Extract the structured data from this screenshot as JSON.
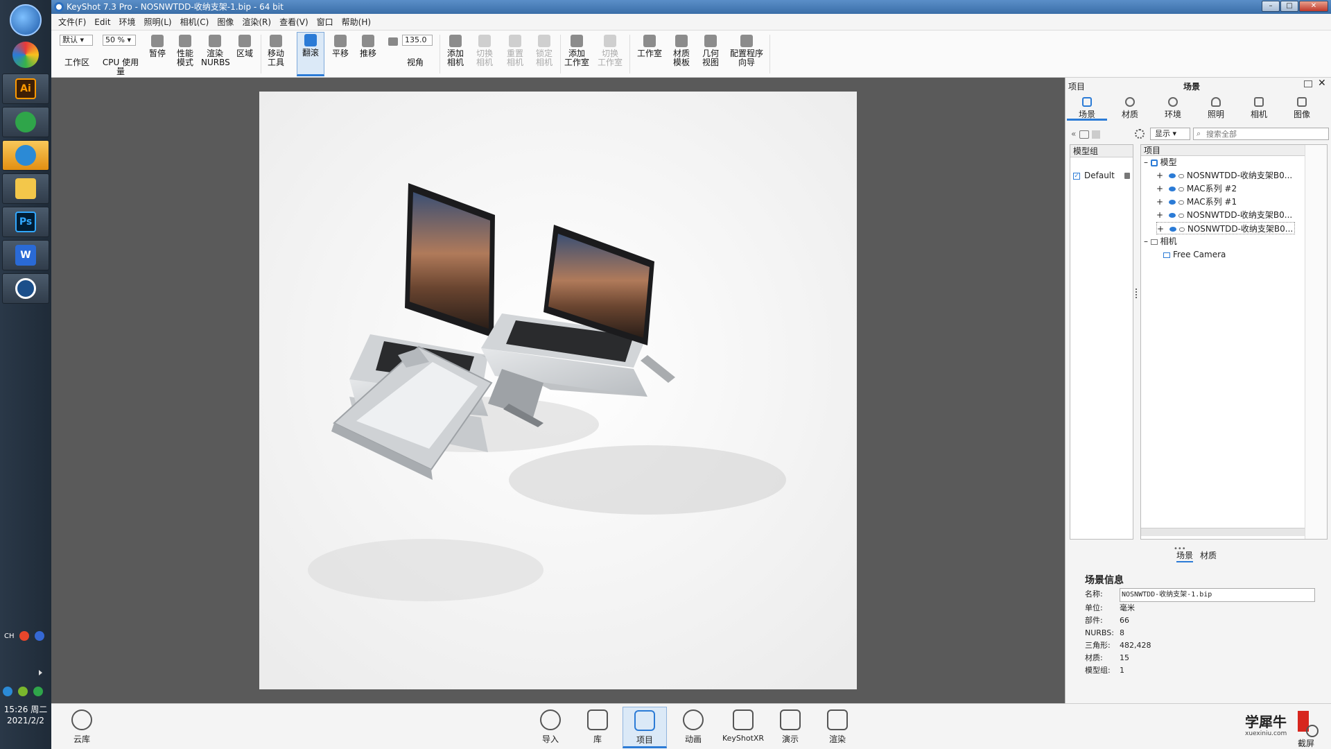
{
  "window": {
    "title": "KeyShot 7.3 Pro  - NOSNWTDD-收纳支架-1.bip  - 64 bit"
  },
  "menu": [
    "文件(F)",
    "Edit",
    "环境",
    "照明(L)",
    "相机(C)",
    "图像",
    "渲染(R)",
    "查看(V)",
    "窗口",
    "帮助(H)"
  ],
  "toolbar": {
    "workspace_select": "默认",
    "workspace_label": "工作区",
    "zoom_select": "50 %",
    "cpu_label": "CPU 使用量",
    "pause_label": "暂停",
    "perf_label": "性能\n模式",
    "nurbs_label": "渲染\nNURBS",
    "region_label": "区域",
    "move_label": "移动\n工具",
    "tumble_label": "翻滚",
    "pan_label": "平移",
    "dolly_label": "推移",
    "fov_value": "135.0",
    "fov_label": "视角",
    "add_cam_label": "添加\n相机",
    "switch_cam_label": "切换\n相机",
    "reset_cam_label": "重置\n相机",
    "lock_cam_label": "锁定\n相机",
    "add_studio_label": "添加\n工作室",
    "switch_studio_label": "切换\n工作室",
    "studio_label": "工作室",
    "mat_template_label": "材质\n模板",
    "geo_view_label": "几何\n视图",
    "wizard_label": "配置程序\n向导"
  },
  "panel": {
    "header_left": "项目",
    "header_center": "场景",
    "tabs": [
      "场景",
      "材质",
      "环境",
      "照明",
      "相机",
      "图像"
    ],
    "display_select": "显示",
    "search_placeholder": "搜索全部",
    "model_group_header": "模型组",
    "model_group_item": "Default",
    "tree_header": "项目",
    "tree_models": "模型",
    "tree_items": [
      "NOSNWTDD-收纳支架B0...",
      "MAC系列 #2",
      "MAC系列 #1",
      "NOSNWTDD-收纳支架B0...",
      "NOSNWTDD-收纳支架B0..."
    ],
    "tree_camera": "相机",
    "tree_free_camera": "Free Camera",
    "subtabs": [
      "场景",
      "材质"
    ],
    "info_title": "场景信息",
    "info": [
      {
        "k": "名称:",
        "v": "NOSNWTDD-收纳支架-1.bip"
      },
      {
        "k": "单位:",
        "v": "毫米"
      },
      {
        "k": "部件:",
        "v": "66"
      },
      {
        "k": "NURBS:",
        "v": "8"
      },
      {
        "k": "三角形:",
        "v": "482,428"
      },
      {
        "k": "材质:",
        "v": "15"
      },
      {
        "k": "模型组:",
        "v": "1"
      }
    ]
  },
  "bottom": {
    "cloud": "云库",
    "buttons": [
      "导入",
      "库",
      "项目",
      "动画",
      "KeyShotXR",
      "演示",
      "渲染"
    ],
    "screenshot": "截屏",
    "watermark": "学犀牛",
    "watermark_url": "xuexiniu.com"
  },
  "taskbar": {
    "time": "15:26 周二",
    "date": "2021/2/2",
    "ime": "CH",
    "apps": [
      "Ai",
      "Ps",
      "W"
    ]
  }
}
